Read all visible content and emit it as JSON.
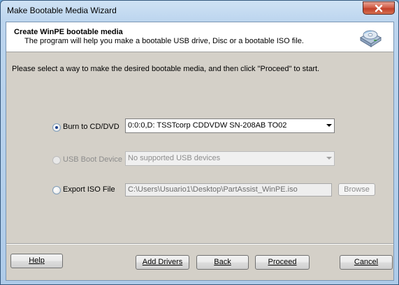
{
  "window": {
    "title": "Make Bootable Media Wizard"
  },
  "header": {
    "title": "Create WinPE bootable media",
    "subtitle": "The program will help you make a bootable USB drive, Disc or a bootable ISO file."
  },
  "instruction": "Please select a way to make the desired bootable media, and then click \"Proceed\" to start.",
  "options": {
    "burn_cd": {
      "label": "Burn to CD/DVD",
      "selected": true,
      "value": "0:0:0,D: TSSTcorp CDDVDW SN-208AB  TO02"
    },
    "usb": {
      "label": "USB Boot Device",
      "selected": false,
      "enabled": false,
      "value": "No supported USB devices"
    },
    "iso": {
      "label": "Export ISO File",
      "selected": false,
      "path": "C:\\Users\\Usuario1\\Desktop\\PartAssist_WinPE.iso",
      "browse_label": "Browse"
    }
  },
  "buttons": {
    "help": "Help",
    "add_drivers": "Add Drivers",
    "back": "Back",
    "proceed": "Proceed",
    "cancel": "Cancel"
  },
  "icons": {
    "close": "close-icon",
    "header": "disc-drive-icon"
  }
}
